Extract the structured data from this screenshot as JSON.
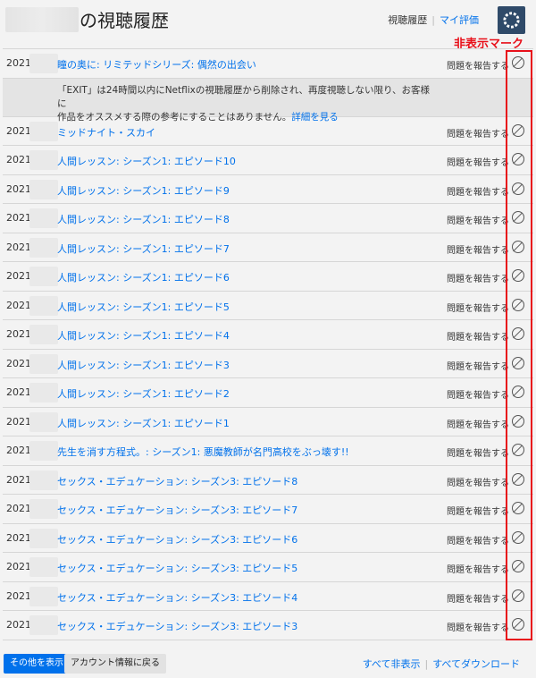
{
  "header": {
    "title": "の視聴履歴",
    "nav_active": "視聴履歴",
    "nav_link": "マイ評価"
  },
  "annotation": {
    "label": "非表示マーク",
    "color": "#e8101a"
  },
  "rows": [
    {
      "date": "2021/",
      "title": "瞳の奥に: リミテッドシリーズ: 偶然の出会い",
      "report": "問題を報告する"
    },
    {
      "date": "2021/",
      "title": "ミッドナイト・スカイ",
      "report": "問題を報告する"
    },
    {
      "date": "2021/",
      "title": "人間レッスン: シーズン1: エピソード10",
      "report": "問題を報告する"
    },
    {
      "date": "2021/",
      "title": "人間レッスン: シーズン1: エピソード9",
      "report": "問題を報告する"
    },
    {
      "date": "2021/",
      "title": "人間レッスン: シーズン1: エピソード8",
      "report": "問題を報告する"
    },
    {
      "date": "2021/",
      "title": "人間レッスン: シーズン1: エピソード7",
      "report": "問題を報告する"
    },
    {
      "date": "2021/",
      "title": "人間レッスン: シーズン1: エピソード6",
      "report": "問題を報告する"
    },
    {
      "date": "2021/",
      "title": "人間レッスン: シーズン1: エピソード5",
      "report": "問題を報告する"
    },
    {
      "date": "2021/",
      "title": "人間レッスン: シーズン1: エピソード4",
      "report": "問題を報告する"
    },
    {
      "date": "2021/",
      "title": "人間レッスン: シーズン1: エピソード3",
      "report": "問題を報告する"
    },
    {
      "date": "2021/",
      "title": "人間レッスン: シーズン1: エピソード2",
      "report": "問題を報告する"
    },
    {
      "date": "2021/",
      "title": "人間レッスン: シーズン1: エピソード1",
      "report": "問題を報告する"
    },
    {
      "date": "2021/",
      "title": "先生を消す方程式。: シーズン1: 悪魔教師が名門高校をぶっ壊す!!",
      "report": "問題を報告する"
    },
    {
      "date": "2021/",
      "title": "セックス・エデュケーション: シーズン3: エピソード8",
      "report": "問題を報告する"
    },
    {
      "date": "2021/",
      "title": "セックス・エデュケーション: シーズン3: エピソード7",
      "report": "問題を報告する"
    },
    {
      "date": "2021/",
      "title": "セックス・エデュケーション: シーズン3: エピソード6",
      "report": "問題を報告する"
    },
    {
      "date": "2021/",
      "title": "セックス・エデュケーション: シーズン3: エピソード5",
      "report": "問題を報告する"
    },
    {
      "date": "2021/",
      "title": "セックス・エデュケーション: シーズン3: エピソード4",
      "report": "問題を報告する"
    },
    {
      "date": "2021/",
      "title": "セックス・エデュケーション: シーズン3: エピソード3",
      "report": "問題を報告する"
    }
  ],
  "notice": {
    "line1": "「EXIT」は24時間以内にNetflixの視聴履歴から削除され、再度視聴しない限り、お客様に",
    "line2": "作品をオススメする際の参考にすることはありません。",
    "link": "詳細を見る"
  },
  "footer": {
    "show_more": "その他を表示",
    "back": "アカウント情報に戻る",
    "hide_all": "すべて非表示",
    "download_all": "すべてダウンロード"
  },
  "icons": {
    "hide": "hide-circle-slash-icon",
    "avatar": "profile-avatar-icon"
  },
  "colors": {
    "link": "#0071eb",
    "annotation": "#e8101a",
    "primary_button": "#0071eb"
  }
}
